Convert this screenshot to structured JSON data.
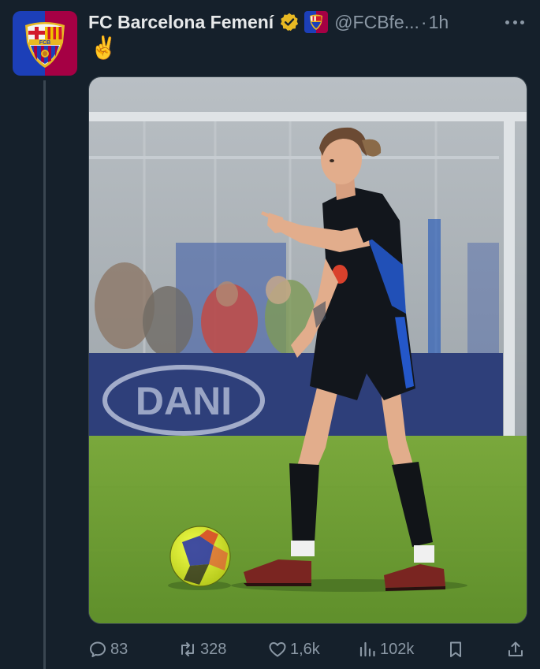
{
  "author": {
    "display_name": "FC Barcelona Femení",
    "handle": "@FCBfe...",
    "separator": "·",
    "time": "1h",
    "avatar_text": "FCB"
  },
  "tweet": {
    "text": "✌️"
  },
  "icons": {
    "avatar": "fcb-crest-icon",
    "verified": "verified-badge-icon",
    "affiliate": "affiliate-badge-icon",
    "more": "more-icon",
    "reply": "reply-icon",
    "retweet": "retweet-icon",
    "like": "like-icon",
    "views": "views-icon",
    "bookmark": "bookmark-icon",
    "share": "share-icon"
  },
  "actions": {
    "replies": "83",
    "retweets": "328",
    "likes": "1,6k",
    "views": "102k"
  },
  "colors": {
    "background": "#15202b",
    "muted": "#8b98a5",
    "verified_gold": "#e8b923",
    "blaugrana_blue": "#1c3fb8",
    "blaugrana_red": "#a50044"
  }
}
